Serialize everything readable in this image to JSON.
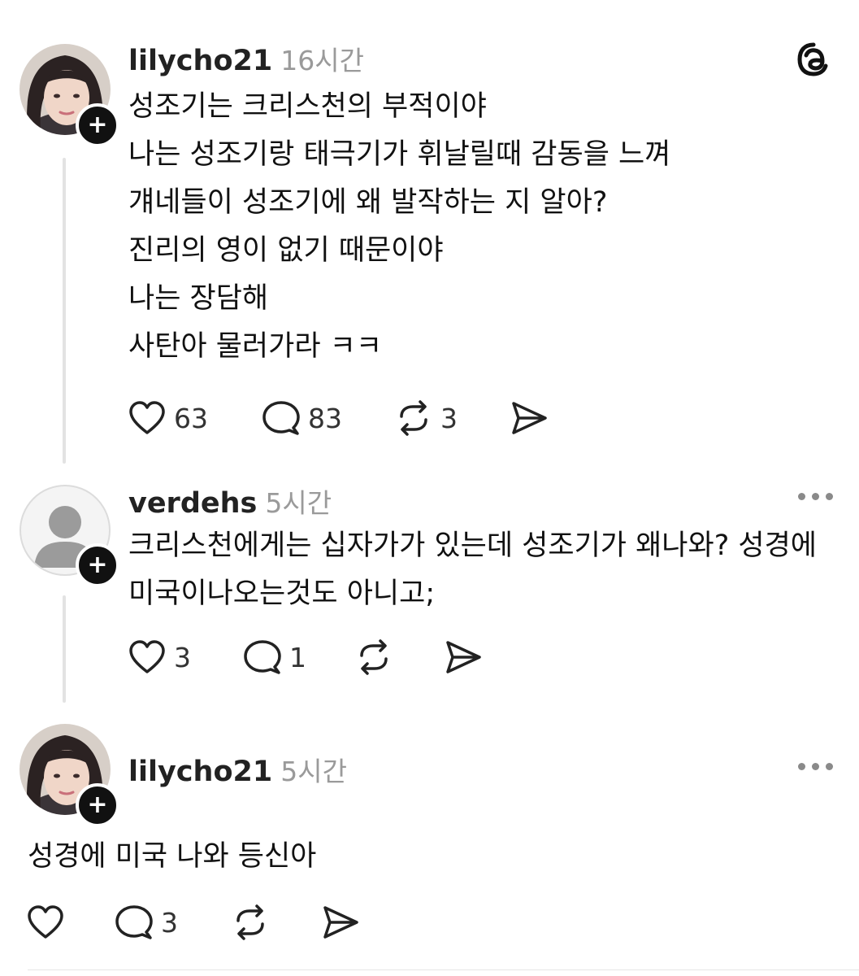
{
  "posts": [
    {
      "username": "lilycho21",
      "time": "16시간",
      "lines": [
        "성조기는 크리스천의 부적이야",
        "나는 성조기랑 태극기가 휘날릴때 감동을 느껴",
        "걔네들이 성조기에 왜 발작하는 지 알아?",
        "진리의 영이 없기 때문이야",
        "나는 장담해",
        "사탄아 물러가라 ㅋㅋ"
      ],
      "likes": "63",
      "comments": "83",
      "reposts": "3"
    },
    {
      "username": "verdehs",
      "time": "5시간",
      "text": "크리스천에게는 십자가가 있는데 성조기가 왜나와? 성경에 미국이나오는것도 아니고;",
      "likes": "3",
      "comments": "1"
    },
    {
      "username": "lilycho21",
      "time": "5시간",
      "text": "성경에 미국 나와 등신아",
      "comments": "3"
    }
  ],
  "icons": [
    "threads-logo-icon",
    "heart-icon",
    "comment-icon",
    "repost-icon",
    "share-icon",
    "more-icon",
    "plus-icon",
    "default-avatar-icon"
  ]
}
